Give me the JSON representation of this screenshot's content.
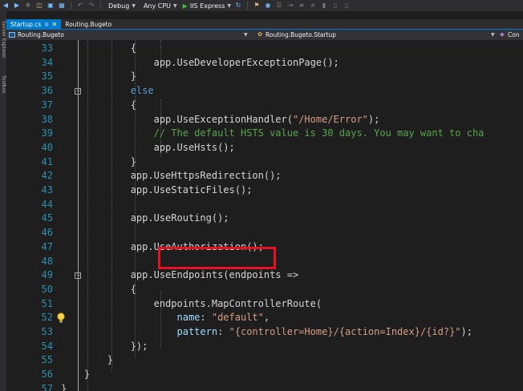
{
  "toolbar": {
    "config_label": "Debug",
    "platform_label": "Any CPU",
    "run_label": "IIS Express"
  },
  "left_strip": {
    "server_explorer": "Server Explorer",
    "toolbox": "Toolbox"
  },
  "tabs": [
    {
      "label": "Startup.cs",
      "active": true
    },
    {
      "label": "Routing.Bugeto",
      "active": false
    }
  ],
  "nav": {
    "project": "Routing.Bugeto",
    "type": "Routing.Bugeto.Startup",
    "member": "Con"
  },
  "lines": [
    {
      "num": "33",
      "text": "            {"
    },
    {
      "num": "34",
      "text": "                app.UseDeveloperExceptionPage();"
    },
    {
      "num": "35",
      "text": "            }"
    },
    {
      "num": "36",
      "text": "            else"
    },
    {
      "num": "37",
      "text": "            {"
    },
    {
      "num": "38",
      "text": "                app.UseExceptionHandler(\"/Home/Error\");"
    },
    {
      "num": "39",
      "text": "                // The default HSTS value is 30 days. You may want to cha"
    },
    {
      "num": "40",
      "text": "                app.UseHsts();"
    },
    {
      "num": "41",
      "text": "            }"
    },
    {
      "num": "42",
      "text": "            app.UseHttpsRedirection();"
    },
    {
      "num": "43",
      "text": "            app.UseStaticFiles();"
    },
    {
      "num": "44",
      "text": ""
    },
    {
      "num": "45",
      "text": "            app.UseRouting();"
    },
    {
      "num": "46",
      "text": ""
    },
    {
      "num": "47",
      "text": "            app.UseAuthorization();"
    },
    {
      "num": "48",
      "text": ""
    },
    {
      "num": "49",
      "text": "            app.UseEndpoints(endpoints =>"
    },
    {
      "num": "50",
      "text": "            {"
    },
    {
      "num": "51",
      "text": "                endpoints.MapControllerRoute("
    },
    {
      "num": "52",
      "text": "                    name: \"default\","
    },
    {
      "num": "53",
      "text": "                    pattern: \"{controller=Home}/{action=Index}/{id?}\");"
    },
    {
      "num": "54",
      "text": "            });"
    },
    {
      "num": "55",
      "text": "        }"
    },
    {
      "num": "56",
      "text": "    }"
    },
    {
      "num": "57",
      "text": "}"
    }
  ],
  "colors": {
    "keyword": "#569cd6",
    "string": "#d69d85",
    "comment": "#57a64a",
    "parameter": "#9cdcfe",
    "line_number": "#2b91af",
    "highlight_border": "#e81123",
    "accent": "#007acc"
  }
}
